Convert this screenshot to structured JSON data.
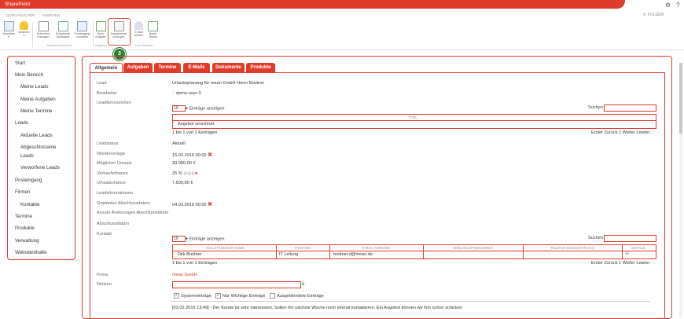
{
  "app_title": "SharePoint",
  "ribbon_tabs": [
    "DURCHSUCHEN",
    "ANSEHEN"
  ],
  "follow_label": "FOLGEN",
  "ribbon": {
    "buttons": [
      {
        "label": "Verwalten"
      },
      {
        "label": "Aktionen"
      },
      {
        "label": "Dokument erzeugen"
      },
      {
        "label": "Dokumente hochladen"
      },
      {
        "label": "Posteingang zuordnen"
      },
      {
        "label": "Neue Aufgabe"
      },
      {
        "label": "Aufgabenset erzeugen"
      },
      {
        "label": "E-Mail senden"
      },
      {
        "label": "Neuer Termin"
      }
    ],
    "groups": [
      "Dokument-Aktionen",
      "Aufgaben",
      "Lead-Aktionen"
    ]
  },
  "step_badge": "3",
  "sidebar": {
    "items": [
      "Start",
      "Mein Bereich",
      "Meine Leads",
      "Meine Aufgaben",
      "Meine Termine",
      "Leads",
      "Aktuelle Leads",
      "Abgeschlossene",
      "Leads",
      "Verworfene Leads",
      "Posteingang",
      "Firmen",
      "Kontakte",
      "Termine",
      "Produkte",
      "Verwaltung",
      "Websiteinhalte"
    ]
  },
  "tabs": [
    "Allgemein",
    "Aufgaben",
    "Termine",
    "E-Mails",
    "Dokumente",
    "Produkte"
  ],
  "fields": {
    "lead_label": "Lead",
    "lead_value": "Urlaubsplanung für mean GmbH Herrn Breitner",
    "bearbeiter_label": "Bearbeiter",
    "bearbeiter_value": "demo-user-3",
    "leadkennzeichen_label": "Leadkennzeichen",
    "leadstatus_label": "Leadstatus",
    "leadstatus_value": "Aktuell",
    "wiedervorlage_label": "Wiedervorlage",
    "wiedervorlage_value": "15.02.2016 00:00",
    "umsatz_label": "Möglicher Umsatz",
    "umsatz_value": "30.000,00 €",
    "verkaufschance_label": "Verkaufschance",
    "verkaufschance_value": "25 %",
    "umsatzchance_label": "Umsatzchance",
    "umsatzchance_value": "7.500,00 €",
    "leadinfo_label": "Leadinformationen",
    "geplant_label": "Geplantes Abschlussdatum",
    "geplant_value": "04.03.2016 00:00",
    "anzahl_label": "Anzahl Änderungen Abschlussdatum",
    "abschluss_label": "Abschlussdatum",
    "kontakt_label": "Kontakt",
    "firma_label": "Firma",
    "firma_value": "mean GmbH",
    "notizen_label": "Notizen"
  },
  "table1": {
    "page_size": "10",
    "entries_label": "Einträge anzeigen",
    "search_label": "Suchen",
    "header": "TITEL",
    "rows": [
      "Angebot verschickt"
    ],
    "info": "1 bis 1 von 1 Einträgen",
    "pager": "Erster Zurück 1 Weiter Letzter"
  },
  "table2": {
    "page_size": "10",
    "entries_label": "Einträge anzeigen",
    "search_label": "Suchen",
    "headers": [
      "VOLLSTÄNDIGER NAME",
      "POSITION",
      "E-MAIL-ADRESSE",
      "MOBILTELEFONNUMMER",
      "TELEFON (GESCHÄFTLICH)",
      "DETAILS"
    ],
    "row": [
      "Dirk Breitner",
      "IT Leitung",
      "breitner.d@mean.de",
      "",
      "",
      ""
    ],
    "info": "1 bis 1 von 1 Einträgen",
    "pager": "Erster Zurück 1 Weiter Letzter"
  },
  "checkboxes": [
    {
      "label": "Systemeinträge",
      "checked": true
    },
    {
      "label": "Nur Wichtige Einträge",
      "checked": true
    },
    {
      "label": "Ausgeblendete Einträge",
      "checked": false
    }
  ],
  "note": "[03.02.2016 13:49] - Der Kunde ist sehr interessiert. Sollen ihn nächste Woche noch einmal kontakieren. Ein Angebot können wir ihm schon schicken",
  "colors": {
    "accent": "#e03a2b",
    "badge": "#2e7d32"
  }
}
